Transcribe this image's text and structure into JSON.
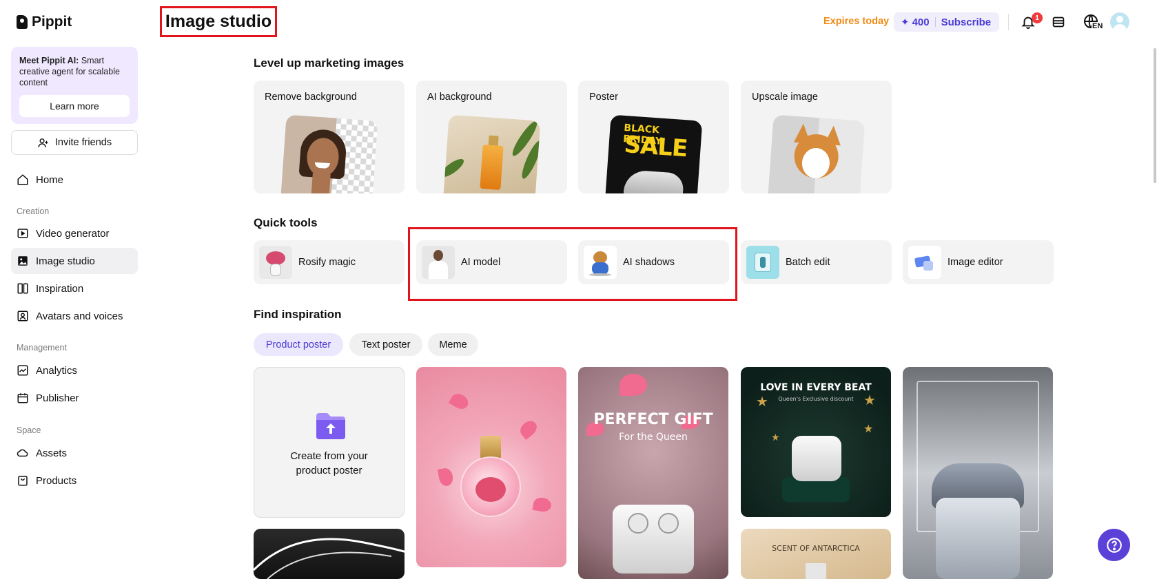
{
  "app": {
    "name": "Pippit"
  },
  "sidebar": {
    "promo": {
      "title": "Meet Pippit AI:",
      "text": " Smart creative agent for scalable content",
      "button": "Learn more"
    },
    "invite": "Invite friends",
    "home": "Home",
    "sections": {
      "creation": "Creation",
      "management": "Management",
      "space": "Space"
    },
    "creation_items": [
      "Video generator",
      "Image studio",
      "Inspiration",
      "Avatars and voices"
    ],
    "management_items": [
      "Analytics",
      "Publisher"
    ],
    "space_items": [
      "Assets",
      "Products"
    ]
  },
  "header": {
    "title": "Image studio",
    "expires": "Expires today",
    "credits": "400",
    "subscribe": "Subscribe",
    "notification_count": "1",
    "language": "EN"
  },
  "marketing": {
    "title": "Level up marketing images",
    "cards": [
      "Remove background",
      "AI background",
      "Poster",
      "Upscale image"
    ],
    "poster_text": {
      "top": "BLACK FRIDAY",
      "big": "SALE"
    }
  },
  "quick_tools": {
    "title": "Quick tools",
    "items": [
      "Rosify magic",
      "AI model",
      "AI shadows",
      "Batch edit",
      "Image editor"
    ]
  },
  "inspiration": {
    "title": "Find inspiration",
    "filters": [
      "Product poster",
      "Text poster",
      "Meme"
    ],
    "active_filter": "Product poster",
    "create_card": "Create from your product poster",
    "gallery_texts": {
      "gift_title": "PERFECT GIFT",
      "gift_sub": "For the Queen",
      "beat_title": "LOVE IN EVERY BEAT",
      "beat_sub": "Queen's Exclusive discount",
      "scent_title": "SCENT OF ANTARCTICA"
    }
  },
  "colors": {
    "accent": "#4b3ad6",
    "expires": "#f08a12",
    "highlight": "#e0141a",
    "help_button": "#5b41d8"
  }
}
